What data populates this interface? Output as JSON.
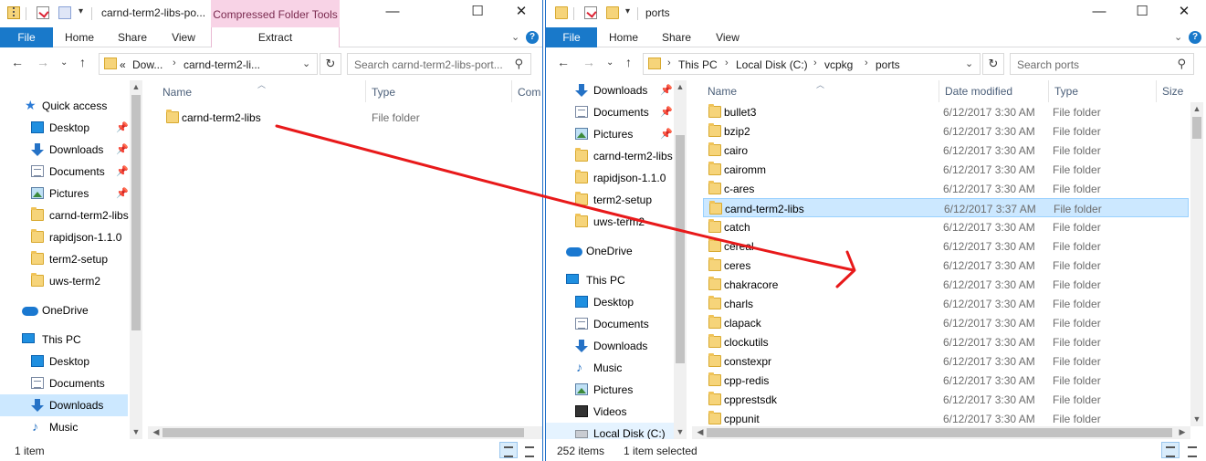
{
  "left": {
    "title": "carnd-term2-libs-po...",
    "context_tab": "Compressed Folder Tools",
    "ribbon_tabs": [
      "File",
      "Home",
      "Share",
      "View"
    ],
    "context_subtab": "Extract",
    "address": {
      "overflow": "«",
      "crumbs": [
        "Dow...",
        "carnd-term2-li..."
      ]
    },
    "search_placeholder": "Search carnd-term2-libs-port...",
    "nav": {
      "quick_access": "Quick access",
      "items": [
        {
          "label": "Desktop",
          "icon": "desktop-icon",
          "pinned": true
        },
        {
          "label": "Downloads",
          "icon": "downloads-icon",
          "pinned": true
        },
        {
          "label": "Documents",
          "icon": "documents-icon",
          "pinned": true
        },
        {
          "label": "Pictures",
          "icon": "pictures-icon",
          "pinned": true
        },
        {
          "label": "carnd-term2-libs",
          "icon": "folder-icon"
        },
        {
          "label": "rapidjson-1.1.0",
          "icon": "folder-icon"
        },
        {
          "label": "term2-setup",
          "icon": "folder-icon"
        },
        {
          "label": "uws-term2",
          "icon": "folder-icon"
        }
      ],
      "onedrive": "OneDrive",
      "this_pc": "This PC",
      "pc_items": [
        {
          "label": "Desktop",
          "icon": "desktop-icon"
        },
        {
          "label": "Documents",
          "icon": "documents-icon"
        },
        {
          "label": "Downloads",
          "icon": "downloads-icon",
          "selected": true
        },
        {
          "label": "Music",
          "icon": "music-icon"
        }
      ]
    },
    "columns": [
      "Name",
      "Type",
      "Com"
    ],
    "files": [
      {
        "name": "carnd-term2-libs",
        "type": "File folder"
      }
    ],
    "status": "1 item"
  },
  "right": {
    "title": "ports",
    "ribbon_tabs": [
      "File",
      "Home",
      "Share",
      "View"
    ],
    "address": {
      "crumbs": [
        "This PC",
        "Local Disk (C:)",
        "vcpkg",
        "ports"
      ]
    },
    "search_placeholder": "Search ports",
    "nav": {
      "items": [
        {
          "label": "Downloads",
          "icon": "downloads-icon",
          "pinned": true
        },
        {
          "label": "Documents",
          "icon": "documents-icon",
          "pinned": true
        },
        {
          "label": "Pictures",
          "icon": "pictures-icon",
          "pinned": true
        },
        {
          "label": "carnd-term2-libs",
          "icon": "folder-icon"
        },
        {
          "label": "rapidjson-1.1.0",
          "icon": "folder-icon"
        },
        {
          "label": "term2-setup",
          "icon": "folder-icon"
        },
        {
          "label": "uws-term2",
          "icon": "folder-icon"
        }
      ],
      "onedrive": "OneDrive",
      "this_pc": "This PC",
      "pc_items": [
        {
          "label": "Desktop",
          "icon": "desktop-icon"
        },
        {
          "label": "Documents",
          "icon": "documents-icon"
        },
        {
          "label": "Downloads",
          "icon": "downloads-icon"
        },
        {
          "label": "Music",
          "icon": "music-icon"
        },
        {
          "label": "Pictures",
          "icon": "pictures-icon"
        },
        {
          "label": "Videos",
          "icon": "videos-icon"
        },
        {
          "label": "Local Disk (C:)",
          "icon": "disk-icon"
        }
      ]
    },
    "columns": [
      "Name",
      "Date modified",
      "Type",
      "Size"
    ],
    "files": [
      {
        "name": "bullet3",
        "date": "6/12/2017 3:30 AM",
        "type": "File folder"
      },
      {
        "name": "bzip2",
        "date": "6/12/2017 3:30 AM",
        "type": "File folder"
      },
      {
        "name": "cairo",
        "date": "6/12/2017 3:30 AM",
        "type": "File folder"
      },
      {
        "name": "cairomm",
        "date": "6/12/2017 3:30 AM",
        "type": "File folder"
      },
      {
        "name": "c-ares",
        "date": "6/12/2017 3:30 AM",
        "type": "File folder"
      },
      {
        "name": "carnd-term2-libs",
        "date": "6/12/2017 3:37 AM",
        "type": "File folder",
        "selected": true
      },
      {
        "name": "catch",
        "date": "6/12/2017 3:30 AM",
        "type": "File folder"
      },
      {
        "name": "cereal",
        "date": "6/12/2017 3:30 AM",
        "type": "File folder"
      },
      {
        "name": "ceres",
        "date": "6/12/2017 3:30 AM",
        "type": "File folder"
      },
      {
        "name": "chakracore",
        "date": "6/12/2017 3:30 AM",
        "type": "File folder"
      },
      {
        "name": "charls",
        "date": "6/12/2017 3:30 AM",
        "type": "File folder"
      },
      {
        "name": "clapack",
        "date": "6/12/2017 3:30 AM",
        "type": "File folder"
      },
      {
        "name": "clockutils",
        "date": "6/12/2017 3:30 AM",
        "type": "File folder"
      },
      {
        "name": "constexpr",
        "date": "6/12/2017 3:30 AM",
        "type": "File folder"
      },
      {
        "name": "cpp-redis",
        "date": "6/12/2017 3:30 AM",
        "type": "File folder"
      },
      {
        "name": "cpprestsdk",
        "date": "6/12/2017 3:30 AM",
        "type": "File folder"
      },
      {
        "name": "cppunit",
        "date": "6/12/2017 3:30 AM",
        "type": "File folder"
      }
    ],
    "status_count": "252 items",
    "status_selected": "1 item selected"
  },
  "annotation_color": "#e8191a"
}
